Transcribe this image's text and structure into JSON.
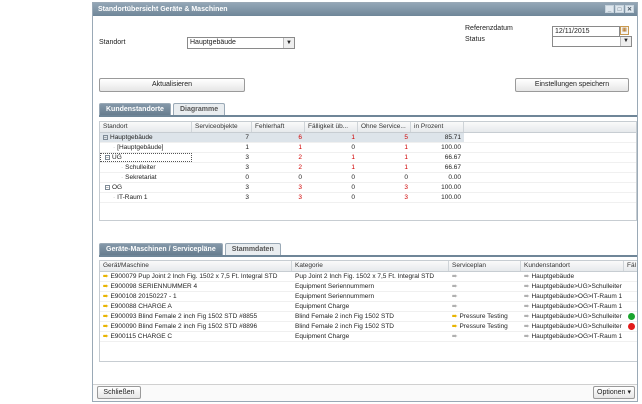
{
  "window": {
    "title": "Standortübersicht Geräte & Maschinen",
    "buttons": [
      "_",
      "□",
      "✕"
    ]
  },
  "filters": {
    "standort_label": "Standort",
    "standort_value": "Hauptgebäude",
    "referenzdatum_label": "Referenzdatum",
    "referenzdatum_value": "12/11/2015",
    "status_label": "Status",
    "status_value": ""
  },
  "actions": {
    "refresh": "Aktualisieren",
    "save_settings": "Einstellungen speichern"
  },
  "top_tabs": [
    "Kundenstandorte",
    "Diagramme"
  ],
  "top_grid": {
    "headers": [
      "Standort",
      "Serviceobjekte",
      "Fehlerhaft",
      "Fälligkeit üb...",
      "Ohne Service...",
      "in Prozent"
    ],
    "rows": [
      {
        "standort": "Hauptgebäude",
        "tree": "minus",
        "serviceobjekte": "7",
        "fehlerhaft": "6",
        "faelligkeit": "1",
        "ohne_service": "5",
        "prozent": "85.71"
      },
      {
        "standort": "[Hauptgebäude]",
        "tree": "",
        "serviceobjekte": "1",
        "fehlerhaft": "1",
        "faelligkeit": "0",
        "ohne_service": "1",
        "prozent": "100.00"
      },
      {
        "standort": "UG",
        "tree": "minus",
        "serviceobjekte": "3",
        "fehlerhaft": "2",
        "faelligkeit": "1",
        "ohne_service": "1",
        "prozent": "66.67"
      },
      {
        "standort": "Schulleiter",
        "tree": "",
        "serviceobjekte": "3",
        "fehlerhaft": "2",
        "faelligkeit": "1",
        "ohne_service": "1",
        "prozent": "66.67"
      },
      {
        "standort": "Sekretariat",
        "tree": "",
        "serviceobjekte": "0",
        "fehlerhaft": "0",
        "faelligkeit": "0",
        "ohne_service": "0",
        "prozent": "0.00"
      },
      {
        "standort": "OG",
        "tree": "minus",
        "serviceobjekte": "3",
        "fehlerhaft": "3",
        "faelligkeit": "0",
        "ohne_service": "3",
        "prozent": "100.00"
      },
      {
        "standort": "IT-Raum 1",
        "tree": "",
        "serviceobjekte": "3",
        "fehlerhaft": "3",
        "faelligkeit": "0",
        "ohne_service": "3",
        "prozent": "100.00"
      }
    ]
  },
  "bottom_tabs": [
    "Geräte-Maschinen / Servicepläne",
    "Stammdaten"
  ],
  "bottom_grid": {
    "headers": [
      "Gerät/Maschine",
      "Kategorie",
      "Serviceplan",
      "Kundenstandort",
      "Fäl"
    ],
    "rows": [
      {
        "geraet": "E900079 Pup Joint 2 Inch Fig. 1502 x 7,5 Ft. Integral STD",
        "kategorie": "Pup Joint 2 Inch Fig. 1502 x 7,5 Ft. Integral STD",
        "serviceplan": "",
        "standort": "Hauptgebäude",
        "status": ""
      },
      {
        "geraet": "E900098 SERIENNUMMER 4",
        "kategorie": "Equipment Seriennummern",
        "serviceplan": "",
        "standort": "Hauptgebäude>UG>Schulleiter",
        "status": ""
      },
      {
        "geraet": "E900108 20150227 - 1",
        "kategorie": "Equipment Seriennummern",
        "serviceplan": "",
        "standort": "Hauptgebäude>OG>IT-Raum 1",
        "status": ""
      },
      {
        "geraet": "E900088 CHARGE A",
        "kategorie": "Equipment Charge",
        "serviceplan": "",
        "standort": "Hauptgebäude>OG>IT-Raum 1",
        "status": ""
      },
      {
        "geraet": "E900093 Blind Female 2 inch Fig 1502 STD #8855",
        "kategorie": "Blind Female 2 inch Fig 1502 STD",
        "serviceplan": "Pressure Testing",
        "standort": "Hauptgebäude>UG>Schulleiter",
        "status": "green"
      },
      {
        "geraet": "E900090 Blind Female 2 inch Fig 1502 STD #8896",
        "kategorie": "Blind Female 2 inch Fig 1502 STD",
        "serviceplan": "Pressure Testing",
        "standort": "Hauptgebäude>UG>Schulleiter",
        "status": "red"
      },
      {
        "geraet": "E900115 CHARGE C",
        "kategorie": "Equipment Charge",
        "serviceplan": "",
        "standort": "Hauptgebäude>OG>IT-Raum 1",
        "status": ""
      }
    ]
  },
  "footer": {
    "close": "Schließen",
    "options": "Optionen"
  },
  "colors": {
    "title_bar": "#6f8698",
    "red_value": "#d00000",
    "status_green": "#1aa52e",
    "status_red": "#e21b1b",
    "arrow_yellow": "#e8b400"
  },
  "icons": {
    "arrow": "arrow-right-icon",
    "calendar": "calendar-icon",
    "tree_toggle": "tree-collapse-icon"
  }
}
